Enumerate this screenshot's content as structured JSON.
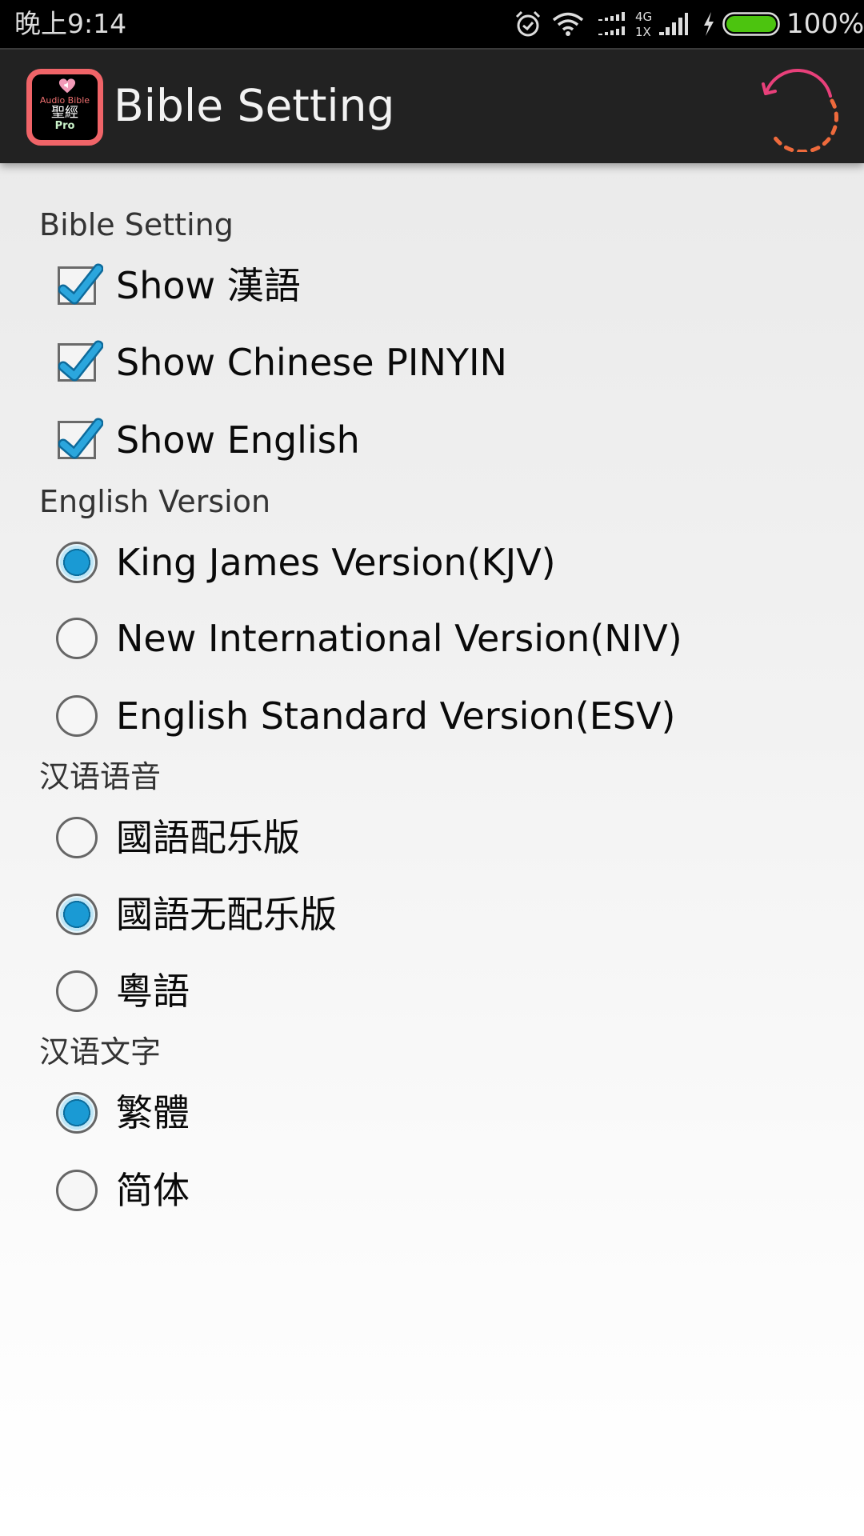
{
  "status_bar": {
    "time": "晚上9:14",
    "icons": [
      "alarm-icon",
      "wifi-icon",
      "dual-signal-icon",
      "signal-icon",
      "charging-icon",
      "battery-icon"
    ],
    "network_top": "4G",
    "network_bottom": "1X",
    "battery_percent": "100%",
    "battery_color": "#4cc40f"
  },
  "toolbar": {
    "app_icon": {
      "line1": "Audio Bible",
      "line2": "聖經",
      "line3": "Pro",
      "border_color": "#f06468"
    },
    "title": "Bible Setting",
    "action_icon": "refresh-icon"
  },
  "sections": [
    {
      "label": "Bible Setting",
      "type": "checkbox",
      "items": [
        {
          "label": "Show 漢語",
          "checked": true
        },
        {
          "label": "Show Chinese PINYIN",
          "checked": true
        },
        {
          "label": "Show English",
          "checked": true
        }
      ]
    },
    {
      "label": "English Version",
      "type": "radio",
      "items": [
        {
          "label": "King James Version(KJV)",
          "checked": true
        },
        {
          "label": "New International Version(NIV)",
          "checked": false
        },
        {
          "label": "English Standard Version(ESV)",
          "checked": false
        }
      ]
    },
    {
      "label": "汉语语音",
      "type": "radio",
      "items": [
        {
          "label": "國語配乐版",
          "checked": false
        },
        {
          "label": "國語无配乐版",
          "checked": true
        },
        {
          "label": "粵語",
          "checked": false
        }
      ]
    },
    {
      "label": "汉语文字",
      "type": "radio",
      "items": [
        {
          "label": "繁體",
          "checked": true
        },
        {
          "label": "简体",
          "checked": false
        }
      ]
    }
  ],
  "colors": {
    "accent": "#1a9ad4",
    "toolbar_bg": "#222222",
    "refresh_arrow": "#e8407a",
    "refresh_dashes": "#ee6a3c"
  }
}
